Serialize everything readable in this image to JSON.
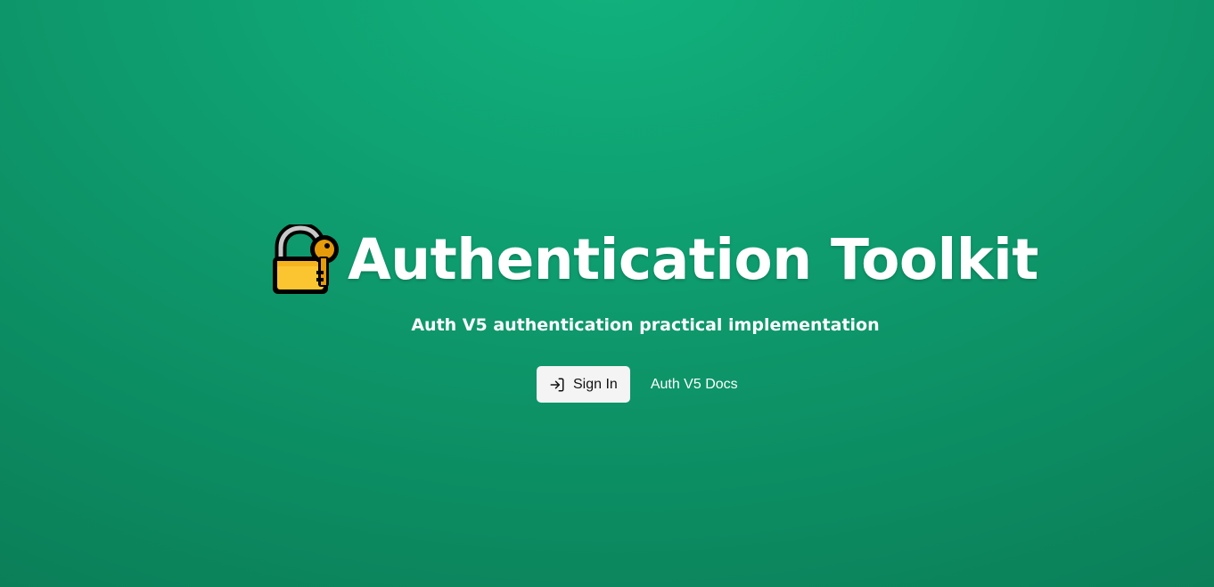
{
  "hero": {
    "title": "Authentication Toolkit",
    "title_icon": "locked-with-key-icon",
    "subtitle": "Auth V5 authentication practical implementation"
  },
  "actions": {
    "sign_in_label": "Sign In",
    "sign_in_icon": "log-in-icon",
    "docs_label": "Auth V5 Docs"
  },
  "colors": {
    "background_top": "#11b27d",
    "background_bottom": "#0a7a55",
    "button_bg": "#f4f4f5",
    "lock_body": "#fbc531",
    "key": "#e69b0a"
  }
}
